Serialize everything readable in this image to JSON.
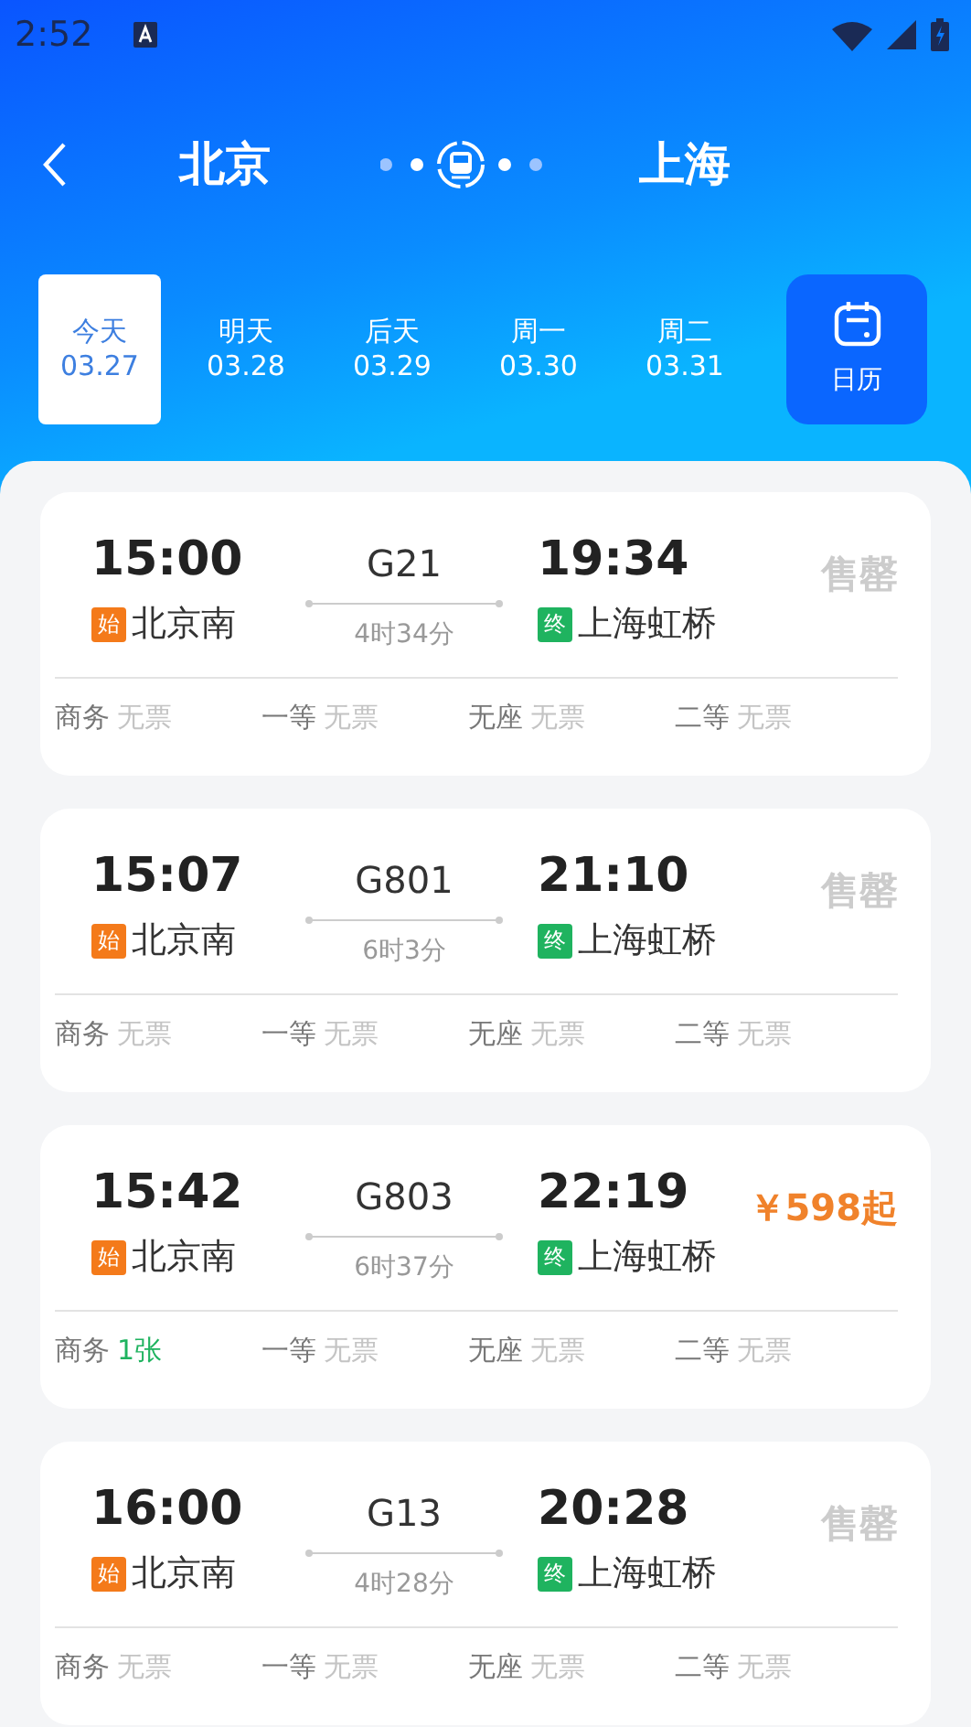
{
  "status_bar": {
    "time": "2:52"
  },
  "route": {
    "from": "北京",
    "to": "上海"
  },
  "dates": [
    {
      "day": "今天",
      "date": "03.27",
      "selected": true
    },
    {
      "day": "明天",
      "date": "03.28",
      "selected": false
    },
    {
      "day": "后天",
      "date": "03.29",
      "selected": false
    },
    {
      "day": "周一",
      "date": "03.30",
      "selected": false
    },
    {
      "day": "周二",
      "date": "03.31",
      "selected": false
    }
  ],
  "calendar_button": {
    "label": "日历"
  },
  "trains": [
    {
      "depart": "15:00",
      "from_tag": "始",
      "from": "北京南",
      "number": "G21",
      "duration": "4时34分",
      "arrive": "19:34",
      "to_tag": "终",
      "to": "上海虹桥",
      "kind": "sold_out",
      "status": "售罄",
      "seats": [
        {
          "class": "商务",
          "availability": "无票",
          "available": false
        },
        {
          "class": "一等",
          "availability": "无票",
          "available": false
        },
        {
          "class": "无座",
          "availability": "无票",
          "available": false
        },
        {
          "class": "二等",
          "availability": "无票",
          "available": false
        }
      ]
    },
    {
      "depart": "15:07",
      "from_tag": "始",
      "from": "北京南",
      "number": "G801",
      "duration": "6时3分",
      "arrive": "21:10",
      "to_tag": "终",
      "to": "上海虹桥",
      "kind": "sold_out",
      "status": "售罄",
      "seats": [
        {
          "class": "商务",
          "availability": "无票",
          "available": false
        },
        {
          "class": "一等",
          "availability": "无票",
          "available": false
        },
        {
          "class": "无座",
          "availability": "无票",
          "available": false
        },
        {
          "class": "二等",
          "availability": "无票",
          "available": false
        }
      ]
    },
    {
      "depart": "15:42",
      "from_tag": "始",
      "from": "北京南",
      "number": "G803",
      "duration": "6时37分",
      "arrive": "22:19",
      "to_tag": "终",
      "to": "上海虹桥",
      "kind": "price",
      "status": "￥598起",
      "seats": [
        {
          "class": "商务",
          "availability": "1张",
          "available": true
        },
        {
          "class": "一等",
          "availability": "无票",
          "available": false
        },
        {
          "class": "无座",
          "availability": "无票",
          "available": false
        },
        {
          "class": "二等",
          "availability": "无票",
          "available": false
        }
      ]
    },
    {
      "depart": "16:00",
      "from_tag": "始",
      "from": "北京南",
      "number": "G13",
      "duration": "4时28分",
      "arrive": "20:28",
      "to_tag": "终",
      "to": "上海虹桥",
      "kind": "sold_out",
      "status": "售罄",
      "seats": [
        {
          "class": "商务",
          "availability": "无票",
          "available": false
        },
        {
          "class": "一等",
          "availability": "无票",
          "available": false
        },
        {
          "class": "无座",
          "availability": "无票",
          "available": false
        },
        {
          "class": "二等",
          "availability": "无票",
          "available": false
        }
      ]
    }
  ]
}
